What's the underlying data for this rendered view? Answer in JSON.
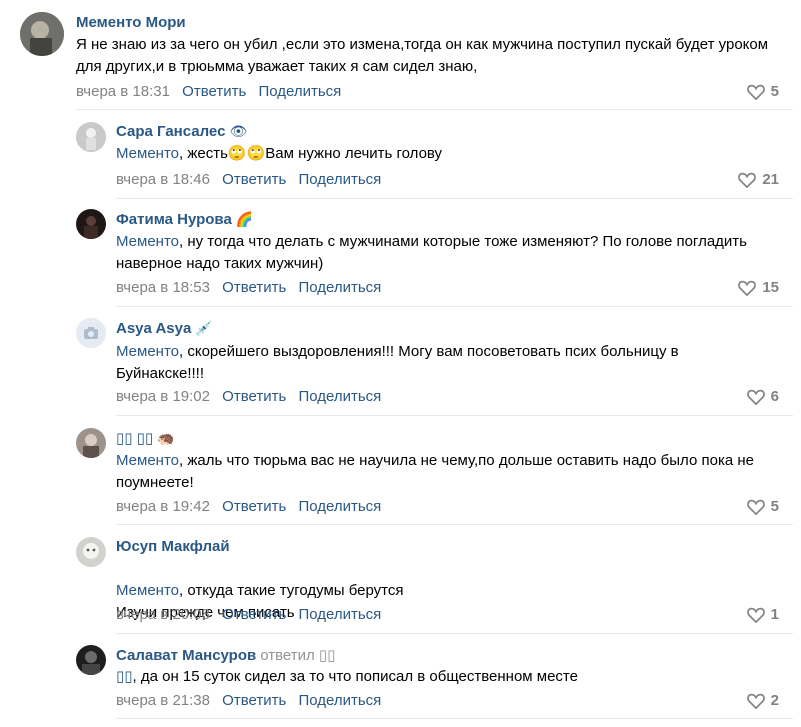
{
  "comments": [
    {
      "author": "Мементо Мори",
      "badge": "",
      "replied": "",
      "mention": "",
      "text": "Я не знаю из за чего он убил ,если это измена,тогда он как мужчина поступил пускай будет уроком для других,и в трюьмма уважает таких я сам сидел знаю,",
      "time": "вчера в 18:31",
      "reply": "Ответить",
      "share": "Поделиться",
      "likes": "5",
      "avatar_color": "#7c7c78"
    },
    {
      "author": "Сара Гансалес",
      "badge": "👁",
      "replied": "",
      "mention": "Мементо",
      "text": ", жесть🙄🙄Вам нужно лечить голову",
      "time": "вчера в 18:46",
      "reply": "Ответить",
      "share": "Поделиться",
      "likes": "21",
      "avatar_color": "#b8b8b8"
    },
    {
      "author": "Фатима Нурова",
      "badge": "🌈",
      "replied": "",
      "mention": "Мементо",
      "text": ", ну тогда что делать с мужчинами которые тоже изменяют? По голове погладить наверное надо таких мужчин)",
      "time": "вчера в 18:53",
      "reply": "Ответить",
      "share": "Поделиться",
      "likes": "15",
      "avatar_color": "#2b2220"
    },
    {
      "author": "Asya Asya",
      "badge": "💉",
      "replied": "",
      "mention": "Мементо",
      "text": ", скорейшего выздоровления!!! Могу вам посоветовать псих больницу в Буйнакске!!!!",
      "time": "вчера в 19:02",
      "reply": "Ответить",
      "share": "Поделиться",
      "likes": "6",
      "avatar_color": "#e5ebf1"
    },
    {
      "author": "▯▯ ▯▯",
      "badge": "🦔",
      "replied": "",
      "mention": "Мементо",
      "text": ", жаль что тюрьма вас не научила не чему,по дольше оставить надо было пока не поумнеете!",
      "time": "вчера в 19:42",
      "reply": "Ответить",
      "share": "Поделиться",
      "likes": "5",
      "avatar_color": "#8a7e76"
    },
    {
      "author": "Юсуп Макфлай",
      "badge": "",
      "replied": "",
      "mention": "Мементо",
      "text": ", откуда такие тугодумы берутся\nИзучи прежде чем писать",
      "time": "вчера в 20:08",
      "reply": "Ответить",
      "share": "Поделиться",
      "likes": "1",
      "avatar_color": "#d9dcd6"
    },
    {
      "author": "Салават Мансуров",
      "badge": "",
      "replied": "ответил ▯▯",
      "mention": "▯▯",
      "text": ", да он 15 суток сидел за то что пописал в общественном месте",
      "time": "вчера в 21:38",
      "reply": "Ответить",
      "share": "Поделиться",
      "likes": "2",
      "avatar_color": "#2f2f2f"
    }
  ],
  "colors": {
    "link": "#2a5885",
    "meta": "#828282",
    "divider": "#e7e8ec"
  },
  "icons": {
    "like": "heart-outline-icon",
    "no_photo": "camera-icon"
  }
}
